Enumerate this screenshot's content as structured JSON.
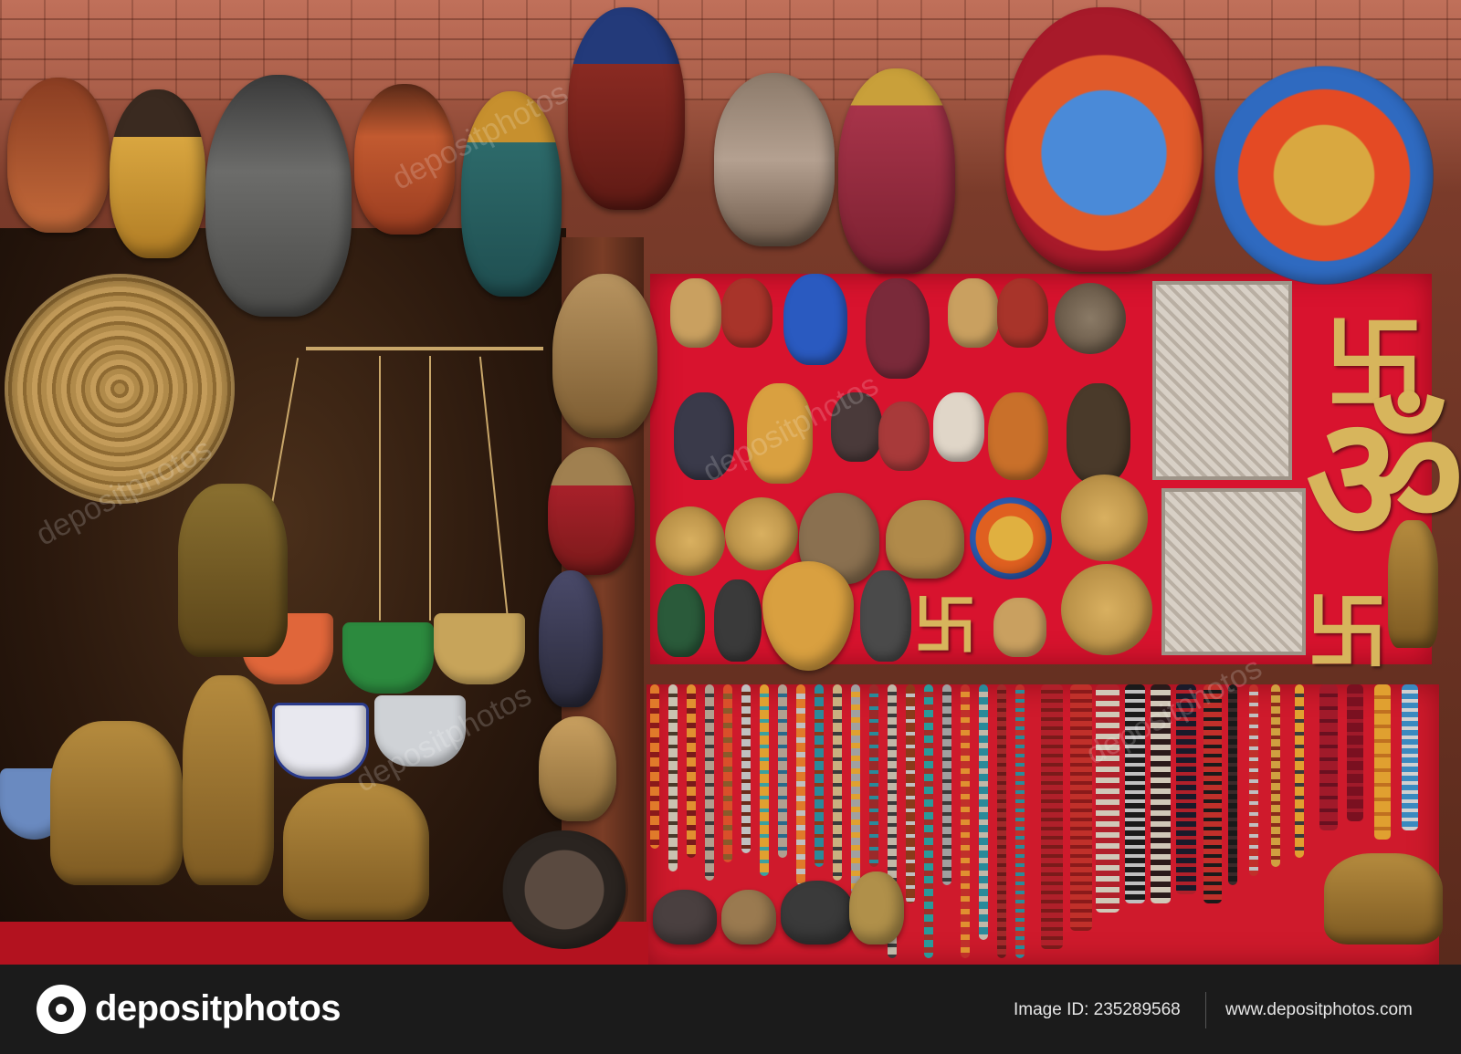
{
  "footer": {
    "logo_text": "depositphotos",
    "image_id": "Image ID: 235289568",
    "site": "www.depositphotos.com"
  },
  "watermark": "depositphotos",
  "colors": {
    "panel_red": "#d8132e",
    "footer_bg": "#1b1b1b",
    "brass": "#b58b3e"
  }
}
